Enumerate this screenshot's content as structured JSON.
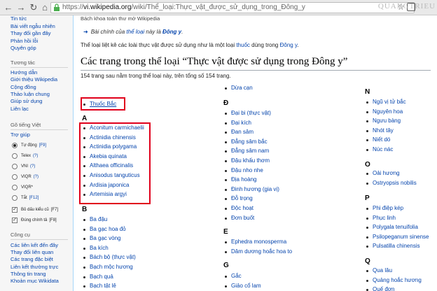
{
  "browser": {
    "url_prefix": "https://",
    "url_host": "vi.wikipedia.org",
    "url_path": "/wiki/Thể_loại:Thực_vật_được_sử_dụng_trong_Đông_y",
    "watermark": "QUANGTRIEU"
  },
  "sidebar": {
    "top_links": [
      "Tin tức",
      "Bài viết ngẫu nhiên",
      "Thay đổi gần đây",
      "Phản hồi lỗi",
      "Quyên góp"
    ],
    "interact_heading": "Tương tác",
    "interact_links": [
      "Hướng dẫn",
      "Giới thiệu Wikipedia",
      "Cộng đồng",
      "Thảo luận chung",
      "Giúp sử dụng",
      "Liên lạc"
    ],
    "typing_heading": "Gõ tiếng Việt",
    "typing_help": "Trợ giúp",
    "input_methods": [
      {
        "label": "Tự động",
        "key": "[F9]",
        "selected": true
      },
      {
        "label": "Telex",
        "key": "(?)",
        "selected": false
      },
      {
        "label": "VNI",
        "key": "(?)",
        "selected": false
      },
      {
        "label": "VIQR",
        "key": "(?)",
        "selected": false
      },
      {
        "label": "VIQR*",
        "key": "",
        "selected": false
      },
      {
        "label": "Tắt",
        "key": "[F12]",
        "selected": false
      }
    ],
    "options": [
      {
        "label": "Bỏ dấu kiểu cũ",
        "key": "[F7]",
        "checked": true
      },
      {
        "label": "Đúng chính tả",
        "key": "[F8]",
        "checked": true
      }
    ],
    "tools_heading": "Công cụ",
    "tools_links": [
      "Các liên kết đến đây",
      "Thay đổi liên quan",
      "Các trang đặc biệt",
      "Liên kết thường trực",
      "Thông tin trang",
      "Khoản mục Wikidata"
    ]
  },
  "content": {
    "subtitle": "Bách khoa toàn thư mở Wikipedia",
    "hatnote": {
      "prefix": "Bài chính của ",
      "link1": "thể loại",
      "middle": " này là ",
      "link2": "Đông y",
      "suffix": "."
    },
    "intro": {
      "prefix": "Thể loại liệt kê các loài thực vật được sử dụng như là một loại ",
      "link1": "thuốc",
      "middle": " dùng trong ",
      "link2": "Đông y",
      "suffix": "."
    },
    "heading": "Các trang trong thể loại “Thực vật được sử dụng trong Đông y”",
    "count": "154 trang sau nằm trong thể loại này, trên tổng số 154 trang."
  },
  "columns": {
    "col1": {
      "top_item": "Thuốc Bắc",
      "groups": [
        {
          "letter": "A",
          "items": [
            "Aconitum carmichaelii",
            "Actinidia chinensis",
            "Actinidia polygama",
            "Akebia quinata",
            "Althaea officinalis",
            "Anisodus tanguticus",
            "Ardisia japonica",
            "Artemisia argyi"
          ]
        },
        {
          "letter": "B",
          "items": [
            "Ba đậu",
            "Ba gạc hoa đỏ",
            "Ba gạc vòng",
            "Ba kích",
            "Bách bộ (thực vật)",
            "Bạch mộc hương",
            "Bạch quả",
            "Bạch tật lê"
          ]
        }
      ]
    },
    "col2": {
      "top_items": [
        "Dừa cạn"
      ],
      "groups": [
        {
          "letter": "Đ",
          "items": [
            "Đại bi (thực vật)",
            "Đại kích",
            "Đan sâm",
            "Đẳng sâm bắc",
            "Đẳng sâm nam",
            "Đậu khấu thơm",
            "Đậu nho nhe",
            "Địa hoàng",
            "Đinh hương (gia vị)",
            "Đỗ trọng",
            "Độc hoạt",
            "Đơn buốt"
          ]
        },
        {
          "letter": "E",
          "items": [
            "Ephedra monosperma",
            "Dâm dương hoắc hoa to"
          ]
        },
        {
          "letter": "G",
          "items": [
            "Gắc",
            "Giảo cổ lam"
          ]
        }
      ]
    },
    "col3": {
      "groups": [
        {
          "letter": "N",
          "items": [
            "Ngũ vị tử bắc",
            "Nguyên hoa",
            "Ngưu bàng",
            "Nhót tây",
            "Niết dó",
            "Núc nác"
          ]
        },
        {
          "letter": "O",
          "items": [
            "Oải hương",
            "Ostryopsis nobilis"
          ]
        },
        {
          "letter": "P",
          "items": [
            "Phi điệp kép",
            "Phục linh",
            "Polygala tenuifolia",
            "Psilopeganum sinense",
            "Pulsatilla chinensis"
          ]
        },
        {
          "letter": "Q",
          "items": [
            "Qua lâu",
            "Quảng hoắc hương",
            "Quế đơn"
          ]
        }
      ]
    }
  },
  "colors": {
    "link": "#0645ad",
    "highlight_box": "#e0001b",
    "sidebar_bg": "#f6f6f6"
  }
}
